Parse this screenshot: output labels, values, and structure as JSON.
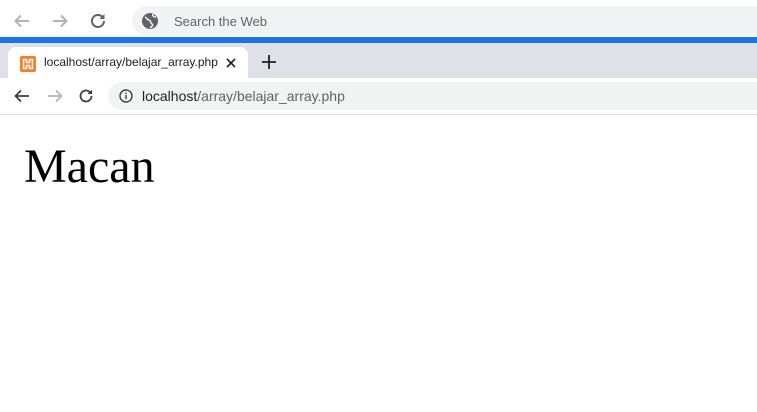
{
  "outer_browser": {
    "search_placeholder": "Search the Web"
  },
  "tab": {
    "title": "localhost/array/belajar_array.php"
  },
  "address_bar": {
    "host": "localhost",
    "path": "/array/belajar_array.php"
  },
  "page": {
    "heading": "Macan"
  },
  "colors": {
    "accent_bar": "#1a73e8",
    "tab_strip": "#dee1e6",
    "favicon": "#fb7a24"
  }
}
